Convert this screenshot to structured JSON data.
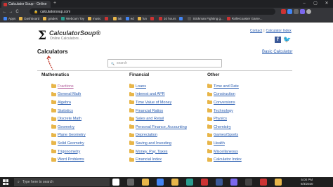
{
  "browser": {
    "tab_title": "Calculator Soup - Online Calculat",
    "new_tab": "+",
    "window_controls": [
      "–",
      "▢",
      "✕"
    ],
    "back": "←",
    "forward": "→",
    "reload": "C",
    "url": "calculatorsoup.com",
    "extension_colors": [
      "#cc3333",
      "#4285f4",
      "#666666",
      "#7b68ee",
      "#aaaaaa"
    ]
  },
  "bookmarks": [
    {
      "label": "Apps",
      "color": "#4285f4"
    },
    {
      "label": "Dashboard",
      "color": "#e8b64a"
    },
    {
      "label": "grades",
      "color": "#e8b64a"
    },
    {
      "label": "Webcam Toy",
      "color": "#2a9d8f"
    },
    {
      "label": "music",
      "color": "#e8b64a"
    },
    {
      "label": "",
      "color": "#cc3333"
    },
    {
      "label": "lab",
      "color": "#e8b64a"
    },
    {
      "label": "ed",
      "color": "#4285f4"
    },
    {
      "label": "fun",
      "color": "#e8b64a"
    },
    {
      "label": "",
      "color": "#cc3333"
    },
    {
      "label": "10 hours",
      "color": "#cc3333"
    },
    {
      "label": "",
      "color": "#4285f4"
    },
    {
      "label": "Stickman Fighting g...",
      "color": "#555555"
    },
    {
      "label": "Rollercoaster Game...",
      "color": "#cc3333"
    }
  ],
  "site": {
    "logo_sigma": "Σ",
    "logo_name": "CalculatorSoup®",
    "tagline": "Online Calculators ...",
    "contact": "Contact",
    "separator": "|",
    "calculator_index": "Calculator Index",
    "facebook": "f",
    "twitter": "🐦",
    "page_title": "Calculators",
    "basic_calculator": "Basic Calculator",
    "search_placeholder": "search",
    "search_icon": "🔍"
  },
  "columns": [
    {
      "heading": "Mathematics",
      "items": [
        "Fractions",
        "General Math",
        "Algebra",
        "Statistics",
        "Discrete Math",
        "Geometry",
        "Plane Geometry",
        "Solid Geometry",
        "Trigonometry",
        "Word Problems"
      ]
    },
    {
      "heading": "Financial",
      "items": [
        "Loans",
        "Interest and APR",
        "Time Value of Money",
        "Financial Ratios",
        "Sales and Retail",
        "Personal Finance, Accounting",
        "Depreciation",
        "Saving and Investing",
        "Money, Pay, Taxes",
        "Financial Index"
      ]
    },
    {
      "heading": "Other",
      "items": [
        "Time and Date",
        "Construction",
        "Conversions",
        "Technology",
        "Physics",
        "Chemistry",
        "Games/Sports",
        "Health",
        "Miscellaneous",
        "Calculator Index"
      ]
    }
  ],
  "taskbar": {
    "search_placeholder": "Type here to search",
    "icon_colors": [
      "#ffffff",
      "#666666",
      "#e8b64a",
      "#4285f4",
      "#e8b64a",
      "#2a9d8f",
      "#cc3333",
      "#3b5998",
      "#7b68ee",
      "#444444",
      "#cc3333",
      "#e8b64a"
    ],
    "time": "5:00 PM",
    "date": "9/3/2020"
  }
}
